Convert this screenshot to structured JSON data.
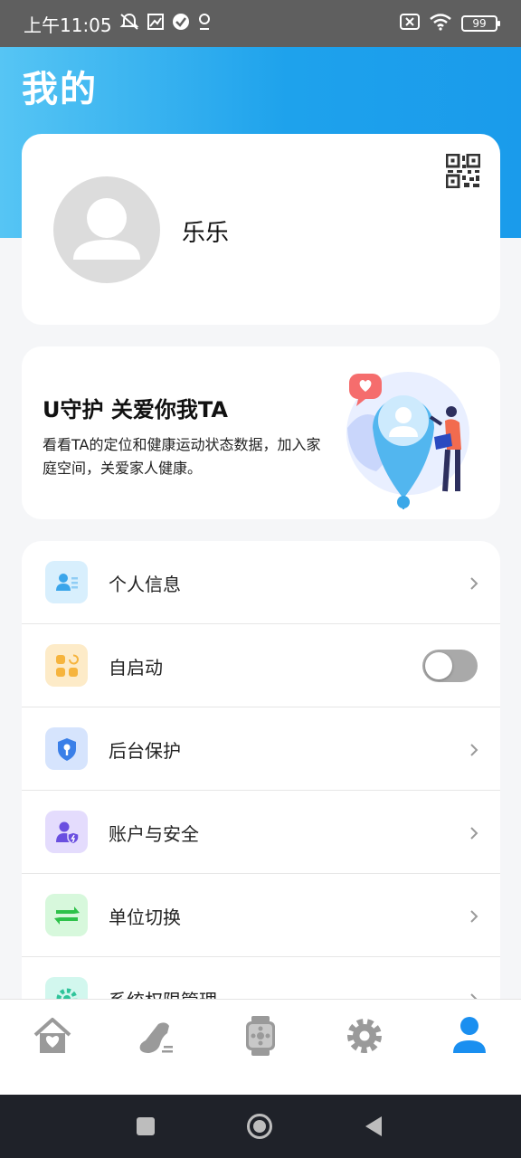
{
  "status_bar": {
    "time": "上午11:05",
    "battery": "99",
    "icons": [
      "mute-icon",
      "image-icon",
      "check-circle-icon",
      "location-icon",
      "sim-off-icon",
      "wifi-icon",
      "battery-icon"
    ]
  },
  "header": {
    "title": "我的",
    "gradient": [
      "#56c5f4",
      "#1a9beb"
    ]
  },
  "profile": {
    "name": "乐乐",
    "avatar_icon": "avatar-placeholder-icon",
    "qr_icon": "qr-code-icon"
  },
  "promo": {
    "title": "U守护 关爱你我TA",
    "description": "看看TA的定位和健康运动状态数据，加入家庭空间，关爱家人健康。"
  },
  "menu": {
    "items": [
      {
        "label": "个人信息",
        "icon": "person-card-icon",
        "type": "link"
      },
      {
        "label": "自启动",
        "icon": "apps-refresh-icon",
        "type": "toggle",
        "enabled": false
      },
      {
        "label": "后台保护",
        "icon": "shield-icon",
        "type": "link"
      },
      {
        "label": "账户与安全",
        "icon": "user-shield-icon",
        "type": "link"
      },
      {
        "label": "单位切换",
        "icon": "swap-icon",
        "type": "link"
      },
      {
        "label": "系统权限管理",
        "icon": "gear-check-icon",
        "type": "link"
      }
    ]
  },
  "tabs": [
    {
      "name": "home",
      "icon": "home-heart-icon",
      "active": false
    },
    {
      "name": "sport",
      "icon": "running-shoe-icon",
      "active": false
    },
    {
      "name": "device",
      "icon": "watch-icon",
      "active": false
    },
    {
      "name": "settings",
      "icon": "gear-icon",
      "active": false
    },
    {
      "name": "mine",
      "icon": "person-icon",
      "active": true
    }
  ],
  "colors": {
    "accent": "#1a9beb",
    "tab_inactive": "#9a9a9a",
    "tab_active": "#1a8ff0"
  }
}
